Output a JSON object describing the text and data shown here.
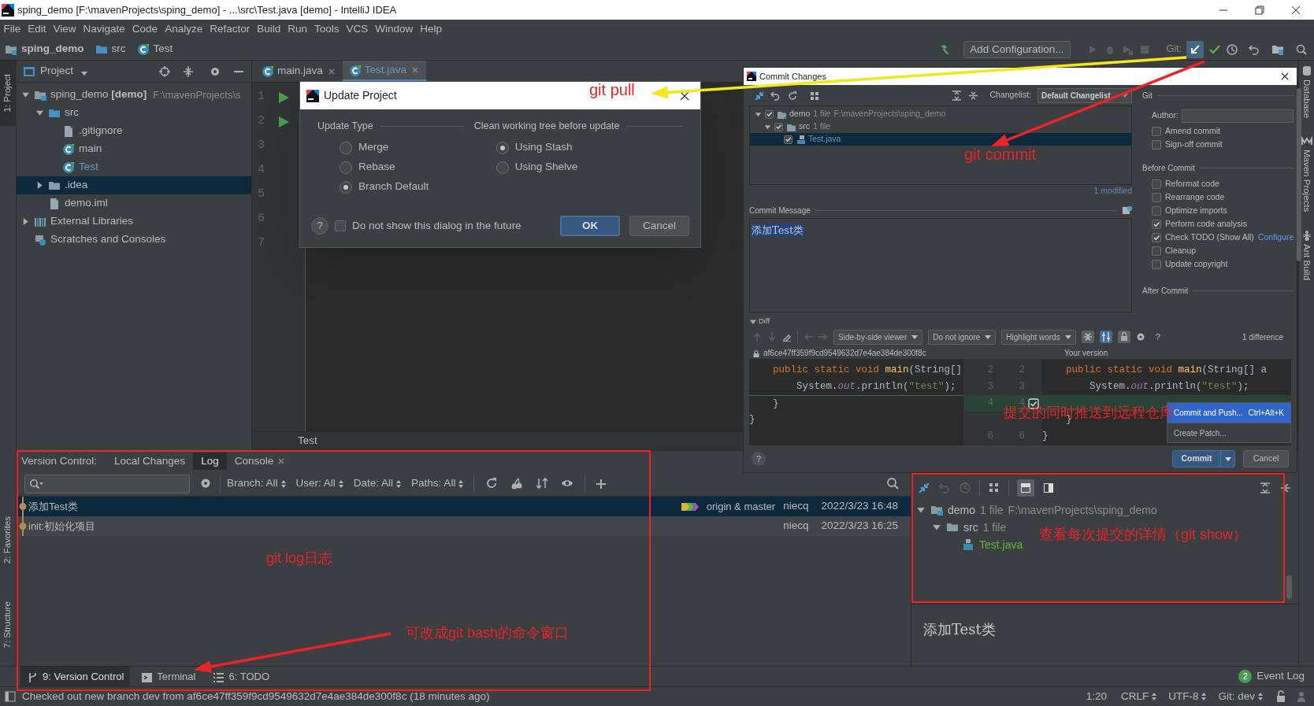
{
  "window": {
    "title": "sping_demo [F:\\mavenProjects\\sping_demo] - ...\\src\\Test.java [demo] - IntelliJ IDEA"
  },
  "menu": [
    "File",
    "Edit",
    "View",
    "Navigate",
    "Code",
    "Analyze",
    "Refactor",
    "Build",
    "Run",
    "Tools",
    "VCS",
    "Window",
    "Help"
  ],
  "breadcrumbs": [
    {
      "label": "sping_demo",
      "kind": "project"
    },
    {
      "label": "src",
      "kind": "folder"
    },
    {
      "label": "Test",
      "kind": "class"
    }
  ],
  "toolbar": {
    "run_configuration": "Add Configuration...",
    "git_label": "Git:"
  },
  "left_tool_windows": [
    {
      "label": "1: Project",
      "selected": true
    },
    {
      "label": "2: Favorites",
      "selected": false
    },
    {
      "label": "7: Structure",
      "selected": false
    }
  ],
  "right_tool_windows": [
    {
      "label": "Database",
      "kind": "database"
    },
    {
      "label": "Maven Projects",
      "kind": "maven"
    },
    {
      "label": "Ant Build",
      "kind": "ant"
    }
  ],
  "project_panel": {
    "title": "Project",
    "tree": [
      {
        "label": "sping_demo **[demo]**",
        "path": "F:\\mavenProjects\\s",
        "kind": "module",
        "expanded": true,
        "selected": false,
        "modified": false,
        "children": [
          {
            "label": "src",
            "kind": "source_folder",
            "expanded": true,
            "selected": false,
            "modified": false,
            "children": [
              {
                "label": ".gitignore",
                "kind": "file",
                "selected": false,
                "modified": false
              },
              {
                "label": "main",
                "kind": "class",
                "selected": false,
                "modified": false
              },
              {
                "label": "Test",
                "kind": "class",
                "selected": false,
                "modified": true
              }
            ]
          },
          {
            "label": ".idea",
            "kind": "folder",
            "expanded": false,
            "selected": true,
            "modified": false
          },
          {
            "label": "demo.iml",
            "kind": "file",
            "selected": false,
            "modified": false
          }
        ]
      },
      {
        "label": "External Libraries",
        "kind": "library",
        "expanded": false,
        "selected": false,
        "modified": false
      },
      {
        "label": "Scratches and Consoles",
        "kind": "scratch",
        "selected": false,
        "modified": false
      }
    ]
  },
  "editor": {
    "tabs": [
      {
        "label": "main.java",
        "selected": false,
        "modified": false
      },
      {
        "label": "Test.java",
        "selected": true,
        "modified": true
      }
    ],
    "lines": [
      {
        "number": "1",
        "run": true
      },
      {
        "number": "2",
        "run": true
      },
      {
        "number": "3",
        "run": false
      },
      {
        "number": "4",
        "run": false
      },
      {
        "number": "5",
        "run": false
      },
      {
        "number": "6",
        "run": false
      },
      {
        "number": "7",
        "run": false
      }
    ],
    "breadcrumb": "Test"
  },
  "update_dialog": {
    "title": "Update Project",
    "update_type": {
      "label": "Update Type",
      "options": [
        {
          "label": "Merge",
          "selected": false
        },
        {
          "label": "Rebase",
          "selected": false
        },
        {
          "label": "Branch Default",
          "selected": true
        }
      ]
    },
    "clean_tree": {
      "label": "Clean working tree before update",
      "options": [
        {
          "label": "Using Stash",
          "selected": true
        },
        {
          "label": "Using Shelve",
          "selected": false
        }
      ]
    },
    "help": "?",
    "dont_show": {
      "label": "Do not show this dialog in the future",
      "checked": false
    },
    "buttons": [
      "OK",
      "Cancel"
    ]
  },
  "commit_dialog": {
    "title": "Commit Changes",
    "changelist_label": "Changelist:",
    "changelist": "Default Changelist",
    "tree": [
      {
        "label": "demo",
        "count": "1 file",
        "path": "F:\\mavenProjects\\sping_demo",
        "kind": "module",
        "checked": true,
        "expanded": true,
        "selected": false,
        "children": [
          {
            "label": "src",
            "count": "1 file",
            "kind": "folder",
            "checked": true,
            "expanded": true,
            "selected": false,
            "children": [
              {
                "label": "Test.java",
                "kind": "java",
                "checked": true,
                "selected": true
              }
            ]
          }
        ]
      }
    ],
    "modified_count": "1 modified",
    "message_label": "Commit Message",
    "message": "添加Test类",
    "git_section": "Git",
    "author_label": "Author:",
    "git_options": [
      {
        "label": "Amend commit",
        "checked": false
      },
      {
        "label": "Sign-off commit",
        "checked": false
      }
    ],
    "before_commit_section": "Before Commit",
    "before_commit": [
      {
        "label": "Reformat code",
        "checked": false
      },
      {
        "label": "Rearrange code",
        "checked": false
      },
      {
        "label": "Optimize imports",
        "checked": false
      },
      {
        "label": "Perform code analysis",
        "checked": true
      },
      {
        "label": "Check TODO (Show All)",
        "link": "Configure",
        "checked": true
      },
      {
        "label": "Cleanup",
        "checked": false
      },
      {
        "label": "Update copyright",
        "checked": false
      }
    ],
    "after_commit_section": "After Commit",
    "diff": {
      "title": "Diff",
      "dropdowns": [
        "Side-by-side viewer",
        "Do not ignore",
        "Highlight words"
      ],
      "help": "?",
      "differences": "1 difference",
      "left_title": "af6ce47ff359f9cd9549632d7e4ae384de300f8c",
      "right_title": "Your version",
      "rows": [
        {
          "left": [
            {
              "text": "    public static void ",
              "kind": "keyword"
            },
            {
              "text": "main",
              "kind": "method"
            },
            {
              "text": "(String[]",
              "kind": "plain"
            }
          ],
          "left_no": "2",
          "right_no": "2",
          "right": [
            {
              "text": "    public static void ",
              "kind": "keyword"
            },
            {
              "text": "main",
              "kind": "method"
            },
            {
              "text": "(String[] a",
              "kind": "plain"
            }
          ],
          "changed": false
        },
        {
          "left": [
            {
              "text": "        System.",
              "kind": "plain"
            },
            {
              "text": "out",
              "kind": "field"
            },
            {
              "text": ".println(",
              "kind": "plain"
            },
            {
              "text": "\"test\"",
              "kind": "string"
            },
            {
              "text": ");",
              "kind": "plain"
            }
          ],
          "left_no": "3",
          "right_no": "3",
          "right": [
            {
              "text": "        System.",
              "kind": "plain"
            },
            {
              "text": "out",
              "kind": "field"
            },
            {
              "text": ".println(",
              "kind": "plain"
            },
            {
              "text": "\"test\"",
              "kind": "string"
            },
            {
              "text": ");",
              "kind": "plain"
            }
          ],
          "changed": false
        },
        {
          "left": [
            {
              "text": "    }",
              "kind": "plain"
            }
          ],
          "left_no": "4",
          "right_no": "4",
          "right": [],
          "changed": true
        },
        {
          "left": [
            {
              "text": "}",
              "kind": "plain"
            }
          ],
          "right": [
            {
              "text": "    }",
              "kind": "plain"
            }
          ],
          "changed": false
        },
        {
          "left": [],
          "left_no": "6",
          "right_no": "6",
          "right": [
            {
              "text": "}",
              "kind": "plain"
            }
          ],
          "changed": false
        }
      ]
    },
    "menu": [
      {
        "label": "Commit and Push...",
        "shortcut": "Ctrl+Alt+K",
        "selected": true
      },
      {
        "label": "Create Patch...",
        "selected": false
      }
    ],
    "help": "?",
    "buttons": [
      "Commit",
      "Cancel"
    ]
  },
  "version_control": {
    "label": "Version Control:",
    "tabs": [
      {
        "label": "Local Changes",
        "selected": false,
        "closable": false
      },
      {
        "label": "Log",
        "selected": true,
        "closable": false
      },
      {
        "label": "Console",
        "selected": false,
        "closable": true
      }
    ],
    "filters": [
      "Branch: All",
      "User: All",
      "Date: All",
      "Paths: All"
    ],
    "commits": [
      {
        "message": "添加Test类",
        "refs": "origin & master",
        "author": "niecq",
        "date": "2022/3/23 16:48",
        "selected": true
      },
      {
        "message": "init:初始化项目",
        "author": "niecq",
        "date": "2022/3/23 16:25",
        "selected": false
      }
    ],
    "changes_tree": [
      {
        "label": "demo",
        "count": "1 file",
        "path": "F:\\mavenProjects\\sping_demo",
        "kind": "module",
        "expanded": true,
        "children": [
          {
            "label": "src",
            "count": "1 file",
            "kind": "folder",
            "expanded": true,
            "children": [
              {
                "label": "Test.java",
                "kind": "java"
              }
            ]
          }
        ]
      }
    ],
    "details_title": "添加Test类"
  },
  "bottom_tools": [
    {
      "label": "9: Version Control",
      "kind": "vcs",
      "selected": true
    },
    {
      "label": "Terminal",
      "kind": "terminal",
      "selected": false
    },
    {
      "label": "6: TODO",
      "kind": "todo",
      "selected": false
    }
  ],
  "event_log": {
    "label": "Event Log",
    "count": "2"
  },
  "status_bar": {
    "message": "Checked out new branch dev from af6ce47ff359f9cd9549632d7e4ae384de300f8c (18 minutes ago)",
    "position": "1:20",
    "line_separator": "CRLF",
    "encoding": "UTF-8",
    "branch": "Git: dev"
  },
  "annotations": {
    "labels": [
      "git pull",
      "git commit",
      "提交的同时推送到远程仓库",
      "git log日志",
      "可改成git bash的命令窗口",
      "查看每次提交的详情（git show）"
    ],
    "frames": [
      {
        "color": "#e8232a"
      },
      {
        "color": "#e8232a"
      }
    ],
    "arrows": [
      {
        "color": "#f2e81c"
      },
      {
        "color": "#e8232a"
      },
      {
        "color": "#e8232a"
      }
    ]
  }
}
